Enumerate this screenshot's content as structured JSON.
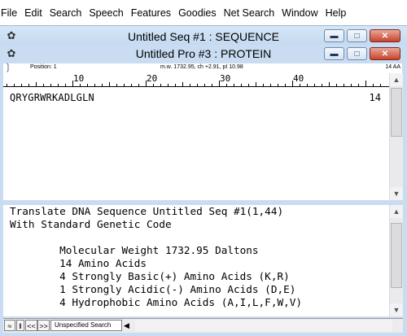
{
  "menu": [
    "File",
    "Edit",
    "Search",
    "Speech",
    "Features",
    "Goodies",
    "Net Search",
    "Window",
    "Help"
  ],
  "back_window": {
    "title": "Untitled Seq #1 : SEQUENCE"
  },
  "front_window": {
    "title": "Untitled Pro #3 : PROTEIN",
    "position_label": "Position: 1",
    "stats": "m.w. 1732.95, ch +2.91, pI 10.98",
    "length_label": "14 AA",
    "ruler_numbers": [
      "10",
      "20",
      "30",
      "40"
    ],
    "sequence": "QRYGRWRKADLGLN",
    "sequence_count": "14"
  },
  "output": {
    "lines": [
      "Translate DNA Sequence Untitled Seq #1(1,44)",
      "With Standard Genetic Code",
      "",
      "        Molecular Weight 1732.95 Daltons",
      "        14 Amino Acids",
      "        4 Strongly Basic(+) Amino Acids (K,R)",
      "        1 Strongly Acidic(-) Amino Acids (D,E)",
      "        4 Hydrophobic Amino Acids (A,I,L,F,W,V)"
    ]
  },
  "bottom_bar": {
    "search_label": "Unspecified Search",
    "nav_buttons": [
      "<<",
      ">>"
    ]
  },
  "icons": {
    "back_window_icon": "dna-app-icon",
    "front_window_icon": "dna-app-icon",
    "tool_icon": "bracket-tool-icon",
    "minimize": "minimize-icon",
    "maximize": "maximize-icon",
    "close": "close-icon"
  }
}
